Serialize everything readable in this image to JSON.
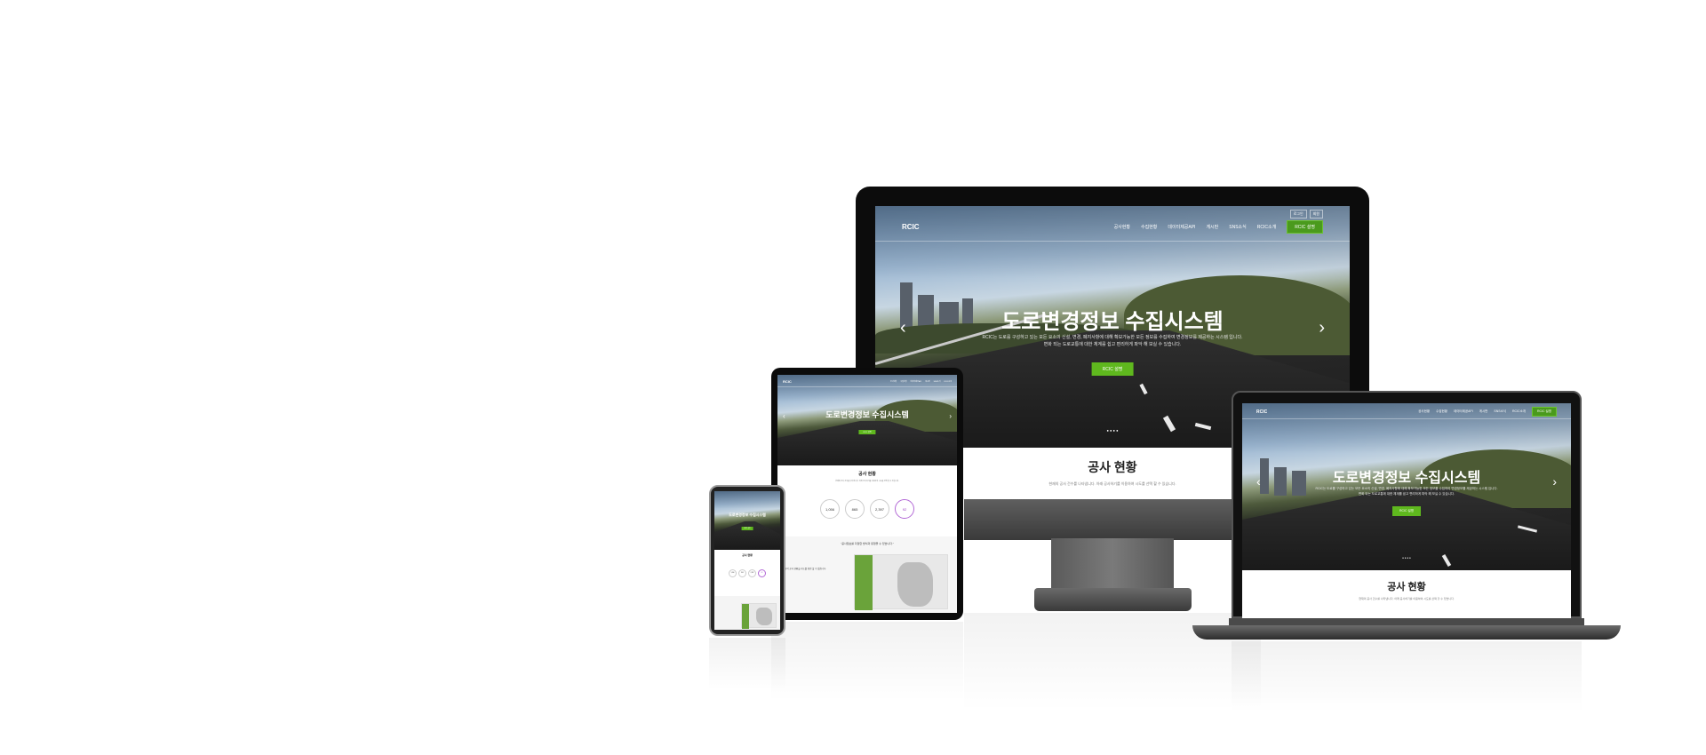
{
  "site": {
    "logo": "RCIC",
    "menu": [
      "공사현황",
      "수집현황",
      "데이터제공API",
      "게시판",
      "SNS소식",
      "RCIC소개"
    ],
    "cta": "RCIC 설명",
    "top_buttons": [
      "로그인",
      "회원"
    ]
  },
  "hero": {
    "title": "도로변경정보 수집시스템",
    "subtitle_line1": "RCIC는 도로를 구성하고 있는 모든 요소의 신설, 변경, 폐지사항에 대해 확보가능한 모든 정보를 수집하여 변경정보를 제공하는 시스템 입니다.",
    "subtitle_line2": "변화 되는 도로교통에 대한 체계를 쉽고 편리하게 파악 해 보실 수 있습니다.",
    "button": "RCIC 설명",
    "prev_arrow": "‹",
    "next_arrow": "›",
    "dots": "● ● ● ●"
  },
  "section": {
    "title": "공사 현황",
    "description": "현재의 공사 건수를 나타냅니다. 아래 공사하기를 이용하여 시도를 선택 할 수 있습니다."
  },
  "stats": {
    "values": [
      "1,056",
      "865",
      "2,397",
      "92"
    ],
    "labels": [
      "총 공사",
      "진행중",
      "완료",
      "예정"
    ]
  },
  "quote": "\"공사정보를 다양한 방식과 유형을 수 있습니다.\"",
  "map_text": "지역 공사 현황을 지도를 확인 할 수 있습니다.",
  "colors": {
    "accent_green": "#5fb81e",
    "purple": "#9a3fc4",
    "device_dark": "#0c0c0c"
  }
}
